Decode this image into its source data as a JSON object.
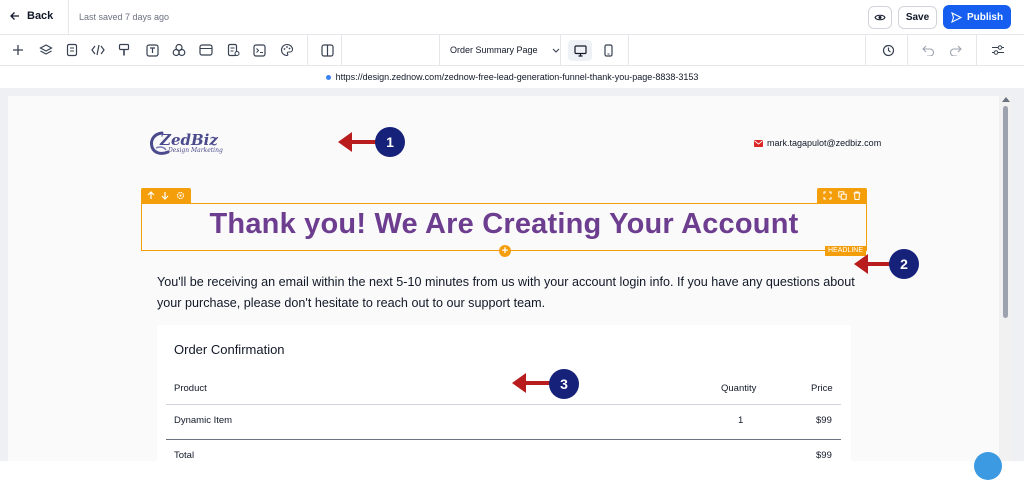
{
  "topbar": {
    "back_label": "Back",
    "saved_text": "Last saved 7 days ago",
    "save_label": "Save",
    "publish_label": "Publish"
  },
  "toolbar": {
    "tools": [
      "plus-icon",
      "layers-icon",
      "page-icon",
      "code-icon",
      "paint-icon",
      "text-icon",
      "shapes-icon",
      "section-icon",
      "form-icon",
      "terminal-icon",
      "palette-icon",
      "columns-icon"
    ],
    "page_select": "Order Summary Page",
    "right_tools": [
      "history-icon",
      "undo-icon",
      "redo-icon",
      "settings-icon"
    ]
  },
  "url": "https://design.zednow.com/zednow-free-lead-generation-funnel-thank-you-page-8838-3153",
  "page": {
    "logo_text": "ZedBiz",
    "logo_sub": "Design Marketing",
    "email": "mark.tagapulot@zedbiz.com",
    "headline": "Thank you! We Are Creating Your Account",
    "headline_tag": "HEADLINE",
    "paragraph": "You'll be receiving an email within the next 5-10 minutes from us with your account login info. If you have any questions about your purchase, please don't hesitate to reach out to our support team."
  },
  "order": {
    "title": "Order Confirmation",
    "headers": {
      "product": "Product",
      "quantity": "Quantity",
      "price": "Price"
    },
    "rows": [
      {
        "product": "Dynamic Item",
        "quantity": "1",
        "price": "$99"
      }
    ],
    "total_label": "Total",
    "total_price": "$99"
  },
  "annotations": [
    "1",
    "2",
    "3"
  ],
  "colors": {
    "accent": "#155eef",
    "headline": "#6d3d8f",
    "selection": "#f59e0b",
    "annotation_arrow": "#b91c1c",
    "annotation_badge": "#16217a"
  }
}
